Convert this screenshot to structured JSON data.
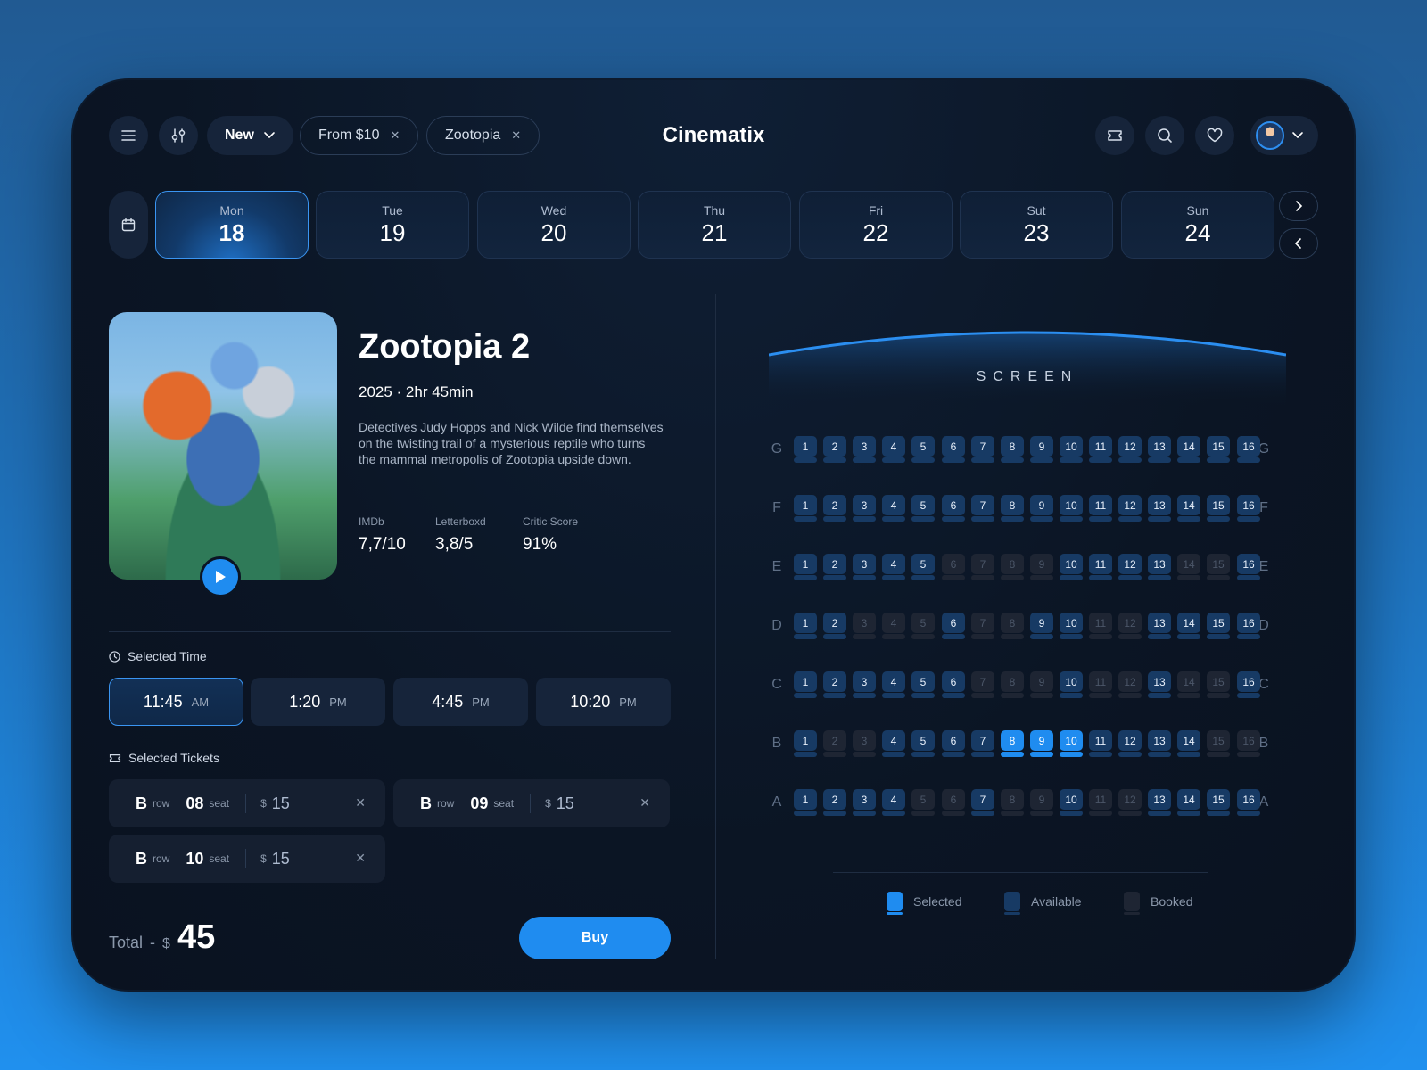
{
  "app": {
    "brand": "Cinematix"
  },
  "filters": {
    "sort": "New",
    "chips": [
      {
        "label": "From $10"
      },
      {
        "label": "Zootopia"
      }
    ]
  },
  "dates": [
    {
      "day": "Mon",
      "date": "18",
      "active": true
    },
    {
      "day": "Tue",
      "date": "19"
    },
    {
      "day": "Wed",
      "date": "20"
    },
    {
      "day": "Thu",
      "date": "21"
    },
    {
      "day": "Fri",
      "date": "22"
    },
    {
      "day": "Sut",
      "date": "23"
    },
    {
      "day": "Sun",
      "date": "24"
    }
  ],
  "movie": {
    "title": "Zootopia 2",
    "meta": "2025 · 2hr 45min",
    "description": "Detectives Judy Hopps and Nick Wilde find themselves on the twisting trail of a mysterious reptile who turns the mammal metropolis of Zootopia upside down.",
    "ratings": [
      {
        "label": "IMDb",
        "value": "7,7/10"
      },
      {
        "label": "Letterboxd",
        "value": "3,8/5"
      },
      {
        "label": "Critic Score",
        "value": "91%"
      }
    ]
  },
  "selected_time": {
    "label": "Selected Time",
    "times": [
      {
        "time": "11:45",
        "ampm": "AM",
        "active": true
      },
      {
        "time": "1:20",
        "ampm": "PM"
      },
      {
        "time": "4:45",
        "ampm": "PM"
      },
      {
        "time": "10:20",
        "ampm": "PM"
      }
    ]
  },
  "selected_tickets": {
    "label": "Selected Tickets",
    "row_word": "row",
    "seat_word": "seat",
    "currency": "$",
    "tickets": [
      {
        "row": "B",
        "seat": "08",
        "price": "15"
      },
      {
        "row": "B",
        "seat": "09",
        "price": "15"
      },
      {
        "row": "B",
        "seat": "10",
        "price": "15"
      }
    ]
  },
  "total": {
    "label": "Total",
    "dash": "-",
    "currency": "$",
    "amount": "45"
  },
  "buy_label": "Buy",
  "screen_label": "SCREEN",
  "seat_map": {
    "rows": [
      "G",
      "F",
      "E",
      "D",
      "C",
      "B",
      "A"
    ],
    "seats_per_row": 16,
    "booked": {
      "G": [],
      "F": [],
      "E": [
        6,
        7,
        8,
        9,
        14,
        15
      ],
      "D": [
        3,
        4,
        5,
        7,
        8,
        11,
        12
      ],
      "C": [
        7,
        8,
        9,
        11,
        12,
        14,
        15
      ],
      "B": [
        2,
        3,
        15,
        16
      ],
      "A": [
        5,
        6,
        8,
        9,
        11,
        12
      ]
    },
    "selected": {
      "B": [
        8,
        9,
        10
      ]
    }
  },
  "legend": [
    {
      "label": "Selected",
      "color": "#1f8cf0"
    },
    {
      "label": "Available",
      "color": "#173a64"
    },
    {
      "label": "Booked",
      "color": "#1e2533"
    }
  ]
}
